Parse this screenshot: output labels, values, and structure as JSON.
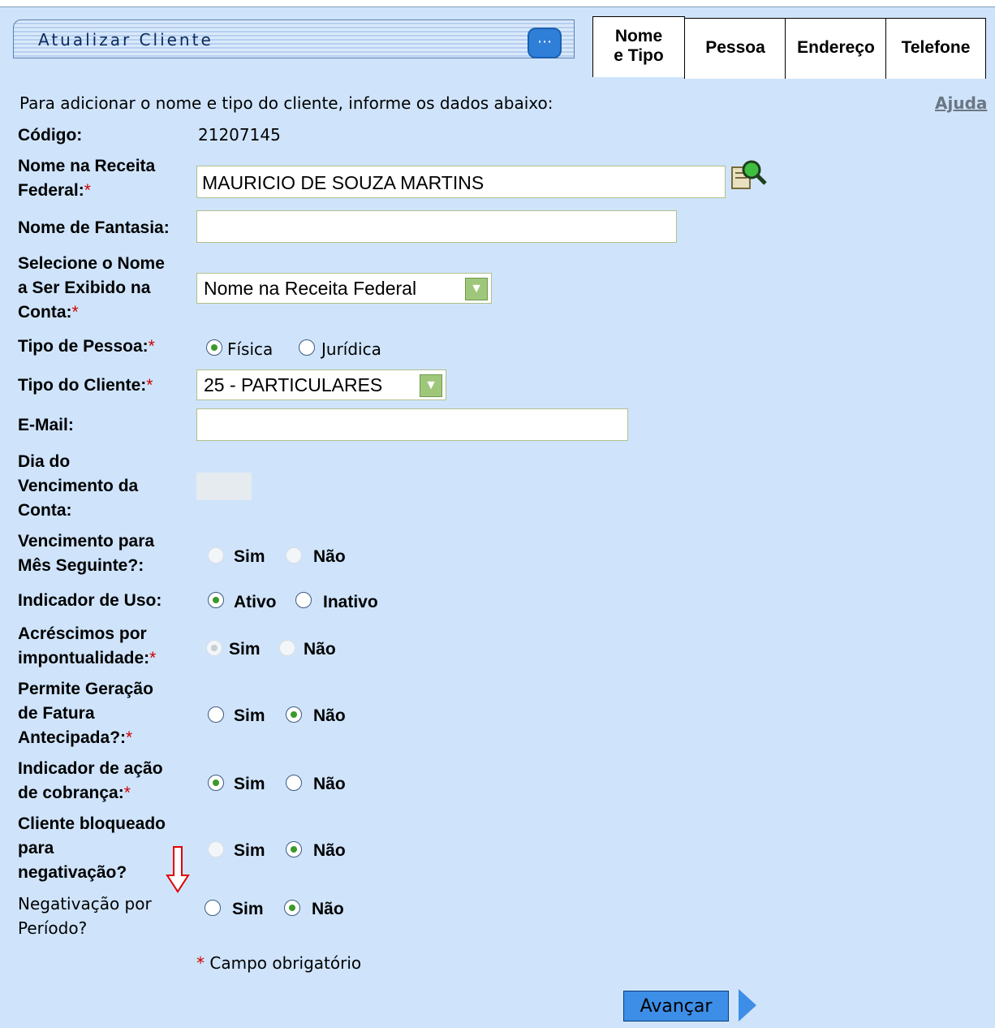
{
  "header": {
    "title": "Atualizar Cliente"
  },
  "tabs": [
    {
      "line1": "Nome",
      "line2": "e Tipo"
    },
    {
      "line1": "Pessoa"
    },
    {
      "line1": "Endereço"
    },
    {
      "line1": "Telefone"
    }
  ],
  "intro": "Para adicionar o nome e tipo do cliente, informe os dados abaixo:",
  "help_link": "Ajuda",
  "fields": {
    "codigo": {
      "label": "Código:",
      "value": "21207145"
    },
    "nome_receita": {
      "label1": "Nome na Receita",
      "label2": "Federal:",
      "value": "MAURICIO DE SOUZA MARTINS"
    },
    "nome_fantasia": {
      "label": "Nome de Fantasia:",
      "value": ""
    },
    "nome_exibido": {
      "label1": "Selecione o Nome",
      "label2": "a Ser Exibido na",
      "label3": "Conta:",
      "value": "Nome na Receita Federal"
    },
    "tipo_pessoa": {
      "label": "Tipo de Pessoa:",
      "opt1": "Física",
      "opt2": "Jurídica"
    },
    "tipo_cliente": {
      "label": "Tipo do Cliente:",
      "value": "25 - PARTICULARES"
    },
    "email": {
      "label": "E-Mail:",
      "value": ""
    },
    "dia_vencimento": {
      "label1": "Dia do",
      "label2": "Vencimento da",
      "label3": "Conta:"
    },
    "venc_mes_seguinte": {
      "label1": "Vencimento para",
      "label2": "Mês Seguinte?:",
      "opt1": "Sim",
      "opt2": "Não"
    },
    "indicador_uso": {
      "label": "Indicador de Uso:",
      "opt1": "Ativo",
      "opt2": "Inativo"
    },
    "acrescimos": {
      "label1": "Acréscimos por",
      "label2": "impontualidade:",
      "opt1": "Sim",
      "opt2": "Não"
    },
    "fatura_antecipada": {
      "label1": "Permite Geração",
      "label2": "de Fatura",
      "label3": "Antecipada?:",
      "opt1": "Sim",
      "opt2": "Não"
    },
    "acao_cobranca": {
      "label1": "Indicador de ação",
      "label2": "de cobrança:",
      "opt1": "Sim",
      "opt2": "Não"
    },
    "bloqueado": {
      "label1": "Cliente bloqueado",
      "label2": "para",
      "label3": "negativação?",
      "opt1": "Sim",
      "opt2": "Não"
    },
    "negativacao_periodo": {
      "label1": "Negativação por",
      "label2": "Período?",
      "opt1": "Sim",
      "opt2": "Não"
    }
  },
  "required_marker": "*",
  "required_note": "Campo obrigatório",
  "button": {
    "advance": "Avançar"
  },
  "colors": {
    "background": "#cfe4fb",
    "button": "#3d8ee6",
    "required": "#d00000"
  }
}
